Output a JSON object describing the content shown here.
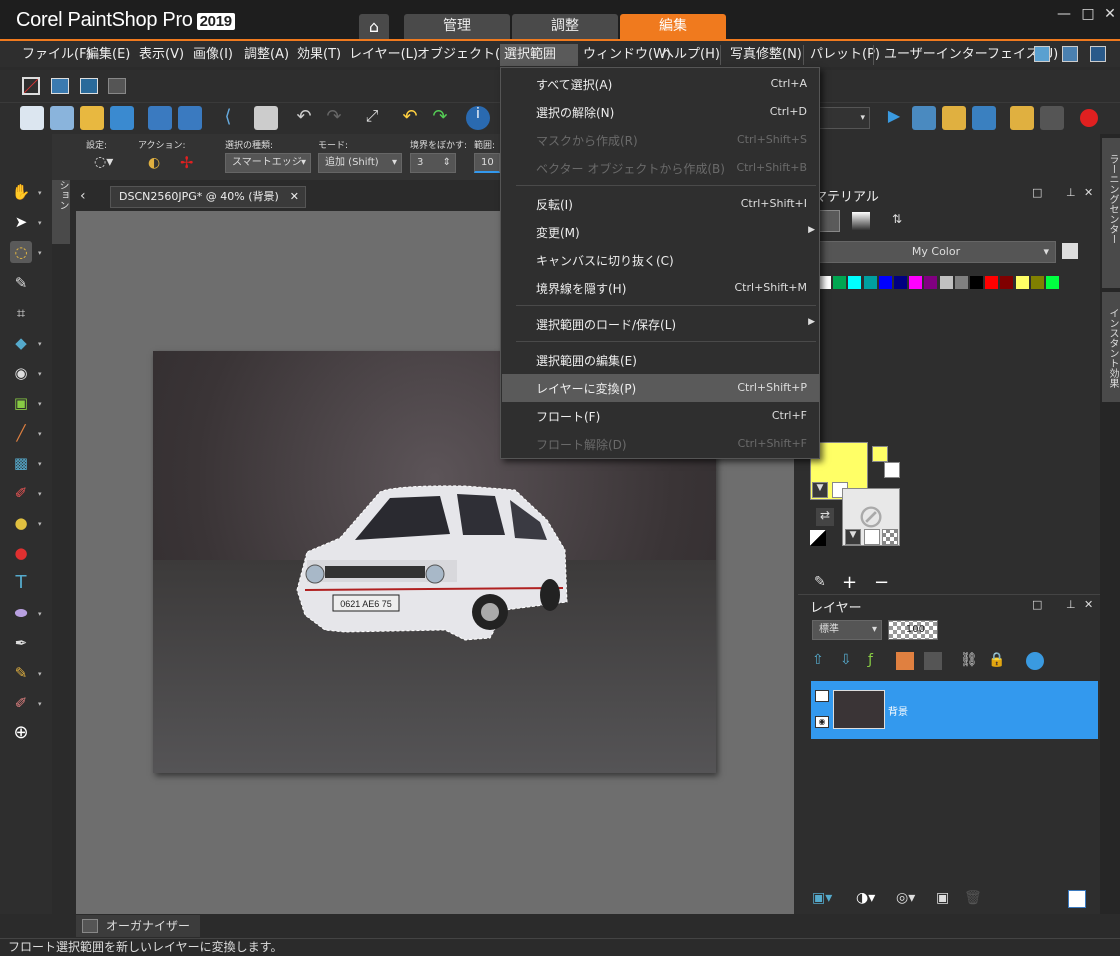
{
  "app": {
    "title": "Corel PaintShop Pro",
    "version": "2019"
  },
  "window_controls": {
    "minimize": "—",
    "maximize": "□",
    "close": "✕"
  },
  "workspace_tabs": [
    {
      "label": "管理"
    },
    {
      "label": "調整"
    },
    {
      "label": "編集",
      "active": true
    }
  ],
  "menubar": {
    "items": [
      "ファイル(F)",
      "編集(E)",
      "表示(V)",
      "画像(I)",
      "調整(A)",
      "効果(T)",
      "レイヤー(L)",
      "オブジェクト(O)",
      "選択範囲(S)",
      "ウィンドウ(W)",
      "ヘルプ(H)",
      "写真修整(N)",
      "パレット(P)",
      "ユーザーインターフェイス(U)"
    ],
    "open_item": "選択範囲(S)"
  },
  "tool_options": {
    "preset_label": "設定:",
    "action_label": "アクション:",
    "selection_type_label": "選択の種類:",
    "selection_type_value": "スマートエッジ",
    "mode_label": "モード:",
    "mode_value": "追加 (Shift)",
    "feather_label": "境界をぼかす:",
    "feather_value": "3",
    "range_label": "範囲:",
    "range_value": "10"
  },
  "navigation_tab": "ナビゲーション",
  "document": {
    "tab_title": "DSCN2560JPG* @ 40% (背景)",
    "close": "✕"
  },
  "organizer": {
    "label": "オーガナイザー"
  },
  "status": {
    "text": "フロート選択範囲を新しいレイヤーに変換します。"
  },
  "materials": {
    "title": "マテリアル",
    "palette": "My Color",
    "swatches": [
      "#ffffff",
      "#00a651",
      "#00ffff",
      "#00a0a0",
      "#0000ff",
      "#000080",
      "#ff00ff",
      "#800080",
      "#c0c0c0",
      "#808080",
      "#000000",
      "#ff0000",
      "#800000",
      "#ffff66",
      "#808000",
      "#00ff40"
    ],
    "foreground": "#ffff66"
  },
  "layers": {
    "title": "レイヤー",
    "blend_mode": "標準",
    "opacity": "100",
    "items": [
      {
        "name": "背景"
      }
    ]
  },
  "right_side_tabs": [
    "ラーニングセンター",
    "インスタント効果"
  ],
  "dropdown": {
    "items": [
      {
        "label": "すべて選択(A)",
        "shortcut": "Ctrl+A"
      },
      {
        "label": "選択の解除(N)",
        "shortcut": "Ctrl+D"
      },
      {
        "label": "マスクから作成(R)",
        "shortcut": "Ctrl+Shift+S",
        "disabled": true
      },
      {
        "label": "ベクター オブジェクトから作成(B)",
        "shortcut": "Ctrl+Shift+B",
        "disabled": true
      },
      {
        "label": "反転(I)",
        "shortcut": "Ctrl+Shift+I"
      },
      {
        "label": "変更(M)",
        "shortcut": "",
        "submenu": true
      },
      {
        "label": "キャンバスに切り抜く(C)",
        "shortcut": ""
      },
      {
        "label": "境界線を隠す(H)",
        "shortcut": "Ctrl+Shift+M"
      },
      {
        "label": "選択範囲のロード/保存(L)",
        "shortcut": "",
        "submenu": true
      },
      {
        "label": "選択範囲の編集(E)",
        "shortcut": ""
      },
      {
        "label": "レイヤーに変換(P)",
        "shortcut": "Ctrl+Shift+P",
        "highlighted": true
      },
      {
        "label": "フロート(F)",
        "shortcut": "Ctrl+F"
      },
      {
        "label": "フロート解除(D)",
        "shortcut": "Ctrl+Shift+F",
        "disabled": true
      }
    ]
  },
  "photo": {
    "plate": "0621 AE6 75"
  }
}
